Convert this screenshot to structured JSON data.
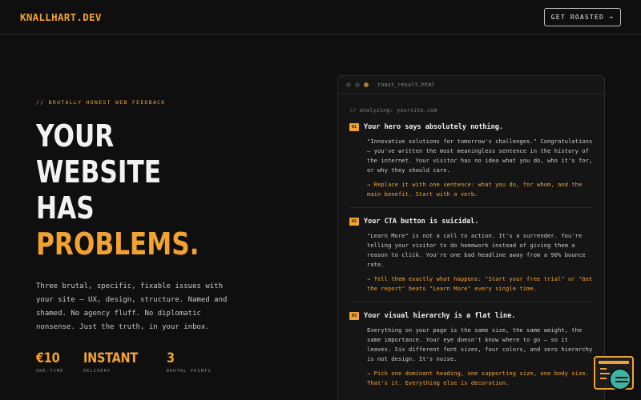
{
  "nav": {
    "logo": "KNALLHART.DEV",
    "cta": "GET ROASTED →"
  },
  "hero": {
    "eyebrow": "// BRUTALLY HONEST WEB FEEDBACK",
    "headline": [
      "YOUR",
      "WEBSITE",
      "HAS"
    ],
    "headline_accent": "PROBLEMS.",
    "subtext": "Three brutal, specific, fixable issues with your site — UX, design, structure. Named and shamed. No agency fluff. No diplomatic nonsense. Just the truth, in your inbox.",
    "stats": [
      {
        "value": "€10",
        "label": "ONE-TIME"
      },
      {
        "value": "INSTANT",
        "label": "DELIVERY"
      },
      {
        "value": "3",
        "label": "BRUTAL POINTS"
      }
    ]
  },
  "panel": {
    "filename": "roast_result.html",
    "comment": "// analyzing: yoursite.com",
    "issues": [
      {
        "num": "01",
        "title": "Your hero says absolutely nothing.",
        "text": "\"Innovative solutions for tomorrow's challenges.\" Congratulations — you've written the most meaningless sentence in the history of the internet. Your visitor has no idea what you do, who it's for, or why they should care.",
        "fix": "→ Replace it with one sentence: what you do, for whom, and the main benefit. Start with a verb."
      },
      {
        "num": "02",
        "title": "Your CTA button is suicidal.",
        "text": "\"Learn More\" is not a call to action. It's a surrender. You're telling your visitor to do homework instead of giving them a reason to click. You're one bad headline away from a 90% bounce rate.",
        "fix": "→ Tell them exactly what happens: \"Start your free trial\" or \"Get the report\" beats \"Learn More\" every single time."
      },
      {
        "num": "03",
        "title": "Your visual hierarchy is a flat line.",
        "text": "Everything on your page is the same size, the same weight, the same importance. Your eye doesn't know where to go — so it leaves. Six different font sizes, four colors, and zero hierarchy is not design. It's noise.",
        "fix": "→ Pick one dominant heading, one supporting size, one body size. That's it. Everything else is decoration."
      }
    ]
  },
  "colors": {
    "accent": "#f2a231",
    "background": "#0f0f0f",
    "panel": "#151515",
    "chat_bubble": "#3fb3a3"
  },
  "icons": {
    "window_dots": [
      "window-dot-icon",
      "window-dot-icon",
      "window-dot-icon"
    ],
    "chat_widget": "chat-widget-icon",
    "chat_bubble": "chat-bubble-icon"
  }
}
